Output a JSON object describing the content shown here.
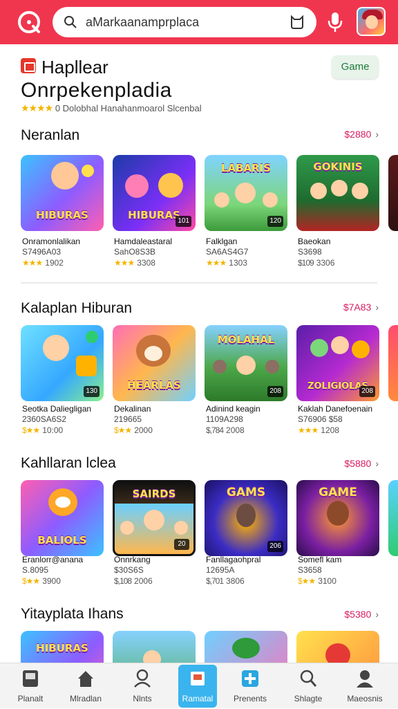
{
  "search": {
    "value": "aMarkaanamprplaca"
  },
  "header": {
    "game_button": "Game"
  },
  "hero": {
    "brand": "Hapllear",
    "title": "Onrpekenpladia",
    "rating_stars": "★★★★",
    "rating_text": "0 Dolobhal Hanahanmoarol Slcenbal"
  },
  "sections": [
    {
      "title": "Neranlan",
      "link": "$2880",
      "cards": [
        {
          "name": "Onramonlalikan",
          "sub": "S7496A03",
          "stars": "★★★",
          "rate": "1902",
          "tag": "",
          "art": "HIBURAS"
        },
        {
          "name": "Hamdaleastaral",
          "sub": "SahO8S3B",
          "stars": "★★★",
          "rate": "3308",
          "tag": "101",
          "art": "HIBURAS"
        },
        {
          "name": "Falklgan",
          "sub": "SA6AS4G7",
          "stars": "★★★",
          "rate": "1303",
          "tag": "120",
          "art": "LABARIS"
        },
        {
          "name": "Baeokan",
          "sub": "S3698",
          "stars": "$109",
          "rate": "3306",
          "tag": "",
          "art": "GOKINIS"
        }
      ]
    },
    {
      "title": "Kalaplan Hiburan",
      "link": "$7A83",
      "cards": [
        {
          "name": "Seotka Daliegligan",
          "sub": "2360SA6S2",
          "stars": "$★★",
          "rate": "10:00",
          "tag": "130",
          "art": ""
        },
        {
          "name": "Dekalinan",
          "sub": "219665",
          "stars": "$★★",
          "rate": "2000",
          "tag": "",
          "art": "HEARLAS"
        },
        {
          "name": "Adinind keagin",
          "sub": "1109A298",
          "stars": "$,784",
          "rate": "2008",
          "tag": "208",
          "art": "MOLAHAL"
        },
        {
          "name": "Kaklah Danefoenain",
          "sub": "S76906 $58",
          "stars": "★★★",
          "rate": "1208",
          "tag": "208",
          "art": "ZOLIGIOLAS"
        }
      ]
    },
    {
      "title": "Kahllaran lclea",
      "link": "$5880",
      "cards": [
        {
          "name": "Eranlorr@anana",
          "sub": "S.8095",
          "stars": "$★★",
          "rate": "3900",
          "tag": "",
          "art": "BALIOLS"
        },
        {
          "name": "Onnrkang",
          "sub": "$30S6S",
          "stars": "$,108",
          "rate": "2006",
          "tag": "20",
          "art": "SAIRDS"
        },
        {
          "name": "Fanllagaohpral",
          "sub": "12695A",
          "stars": "$,701",
          "rate": "3806",
          "tag": "206",
          "art": "GAMS"
        },
        {
          "name": "Somefl kam",
          "sub": "S3658",
          "stars": "$★★",
          "rate": "3100",
          "tag": "",
          "art": "GAME"
        }
      ]
    },
    {
      "title": "Yitayplata Ihans",
      "link": "$5380",
      "cards": [
        {
          "name": "",
          "sub": "",
          "stars": "",
          "rate": "",
          "tag": "",
          "art": "HIBURAS"
        },
        {
          "name": "",
          "sub": "",
          "stars": "",
          "rate": "",
          "tag": "",
          "art": ""
        },
        {
          "name": "",
          "sub": "",
          "stars": "",
          "rate": "",
          "tag": "",
          "art": ""
        },
        {
          "name": "",
          "sub": "",
          "stars": "",
          "rate": "",
          "tag": "",
          "art": ""
        }
      ]
    }
  ],
  "nav": [
    {
      "label": "Planalt",
      "icon": "tablet-icon"
    },
    {
      "label": "Mlradlan",
      "icon": "home-icon"
    },
    {
      "label": "Nlnts",
      "icon": "user-icon"
    },
    {
      "label": "Ramatal",
      "icon": "book-icon",
      "active": true
    },
    {
      "label": "Prenents",
      "icon": "plus-icon"
    },
    {
      "label": "Shlagte",
      "icon": "search-icon"
    },
    {
      "label": "Maeosnis",
      "icon": "profile-icon"
    }
  ],
  "colors": {
    "brand": "#f0364f",
    "link": "#d81b60",
    "active_nav": "#3ab4ee",
    "stars": "#f4b400"
  }
}
